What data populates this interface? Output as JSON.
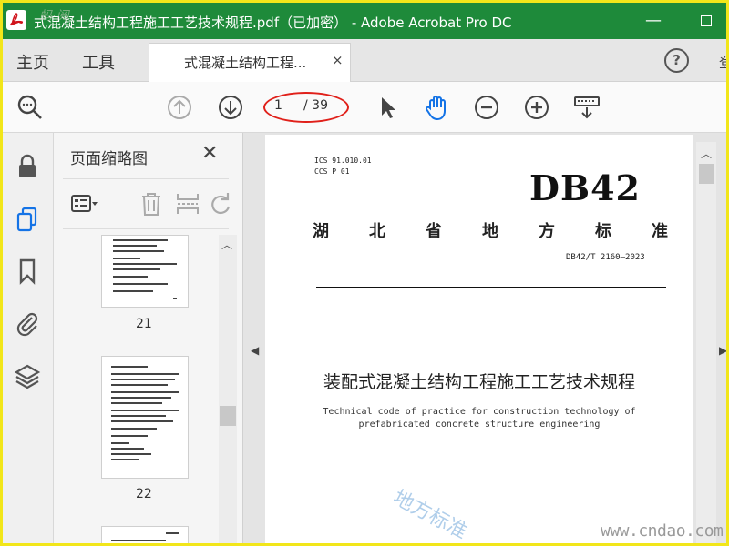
{
  "window": {
    "title": "式混凝土结构工程施工工艺技术规程.pdf（已加密） - Adobe Acrobat Pro DC",
    "minimize_label": "—"
  },
  "tabs": {
    "home": "主页",
    "tools": "工具",
    "doc_tab": "式混凝土结构工程...",
    "doc_close": "×",
    "help": "?",
    "cut_text": "登"
  },
  "toolbar": {
    "current_page": "1",
    "total_pages": "/ 39",
    "icons": [
      "search-zoom-icon",
      "page-up-icon",
      "page-down-icon",
      "select-cursor-icon",
      "hand-tool-icon",
      "zoom-out-icon",
      "zoom-in-icon",
      "keyboard-scroll-icon"
    ],
    "accent": "#1473e6",
    "annotation_color": "#e0201a"
  },
  "rail": {
    "icons": [
      "lock-icon",
      "pages-icon",
      "bookmark-icon",
      "attachment-icon",
      "layers-icon"
    ]
  },
  "thumbnails": {
    "title": "页面缩略图",
    "close": "✕",
    "pages": [
      {
        "number": "21"
      },
      {
        "number": "22"
      }
    ]
  },
  "document": {
    "ics": "ICS  91.010.01",
    "ccs": "CCS  P 01",
    "code": "DB42",
    "std_name_chars": [
      "湖",
      "北",
      "省",
      "地",
      "方",
      "标",
      "准"
    ],
    "std_number": "DB42/T 2160—2023",
    "title_cn": "装配式混凝土结构工程施工工艺技术规程",
    "title_en_1": "Technical code of practice for construction technology of",
    "title_en_2": "prefabricated concrete structure engineering",
    "watermark": "地方标准",
    "site_watermark": "www.cndao.com",
    "corner_watermark": "蚂·阅"
  },
  "colors": {
    "titlebar": "#1e8a3a",
    "frame": "#f2e61a"
  }
}
